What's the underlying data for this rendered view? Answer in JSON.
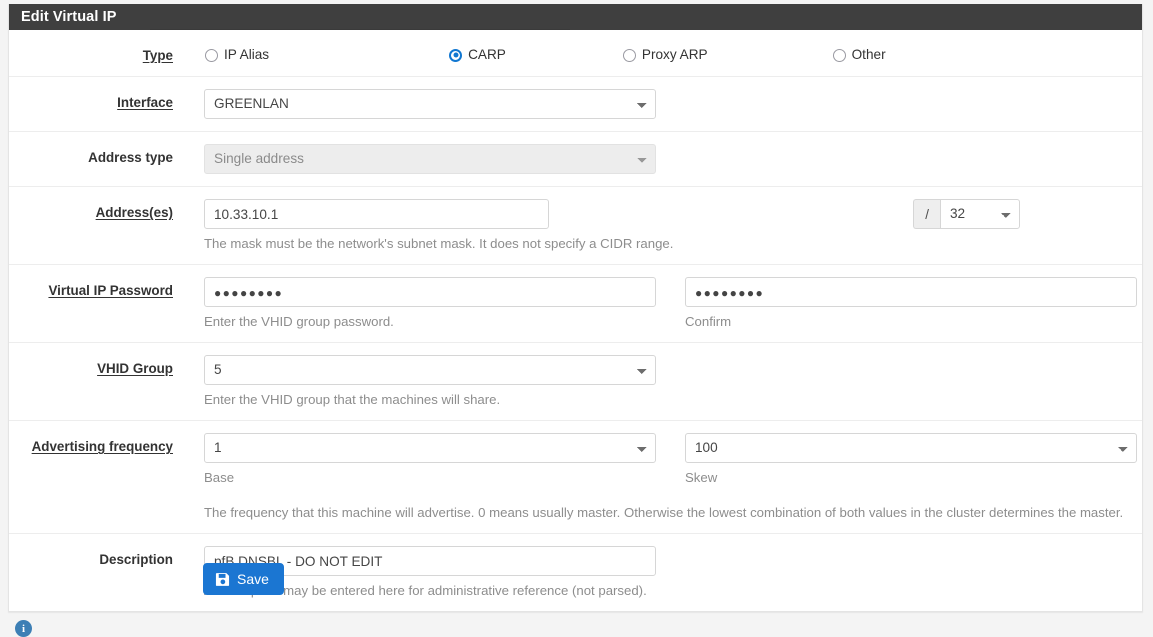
{
  "panel": {
    "title": "Edit Virtual IP"
  },
  "rows": {
    "type": {
      "label": "Type",
      "required": true,
      "options": [
        {
          "label": "IP Alias",
          "checked": false
        },
        {
          "label": "CARP",
          "checked": true
        },
        {
          "label": "Proxy ARP",
          "checked": false
        },
        {
          "label": "Other",
          "checked": false
        }
      ]
    },
    "interface": {
      "label": "Interface",
      "required": true,
      "value": "GREENLAN"
    },
    "address_type": {
      "label": "Address type",
      "required": false,
      "value": "Single address",
      "disabled": true
    },
    "addresses": {
      "label": "Address(es)",
      "required": true,
      "value": "10.33.10.1",
      "prefix_symbol": "/",
      "cidr": "32",
      "help": "The mask must be the network's subnet mask. It does not specify a CIDR range."
    },
    "vip_password": {
      "label": "Virtual IP Password",
      "required": true,
      "value": "●●●●●●●●",
      "help": "Enter the VHID group password.",
      "confirm_value": "●●●●●●●●",
      "confirm_help": "Confirm"
    },
    "vhid_group": {
      "label": "VHID Group",
      "required": true,
      "value": "5",
      "help": "Enter the VHID group that the machines will share."
    },
    "advertising_frequency": {
      "label": "Advertising frequency",
      "required": true,
      "base_value": "1",
      "base_help": "Base",
      "skew_value": "100",
      "skew_help": "Skew",
      "help": "The frequency that this machine will advertise. 0 means usually master. Otherwise the lowest combination of both values in the cluster determines the master."
    },
    "description": {
      "label": "Description",
      "required": false,
      "value": "pfB DNSBL - DO NOT EDIT",
      "help": "A description may be entered here for administrative reference (not parsed)."
    }
  },
  "footer": {
    "save_label": "Save",
    "info_glyph": "i"
  },
  "colors": {
    "header_bg": "#3f3f3f",
    "accent": "#1b76d2",
    "radio_selected": "#1177d1",
    "page_bg": "#f4f4f4",
    "info_badge": "#3d7fb5"
  }
}
